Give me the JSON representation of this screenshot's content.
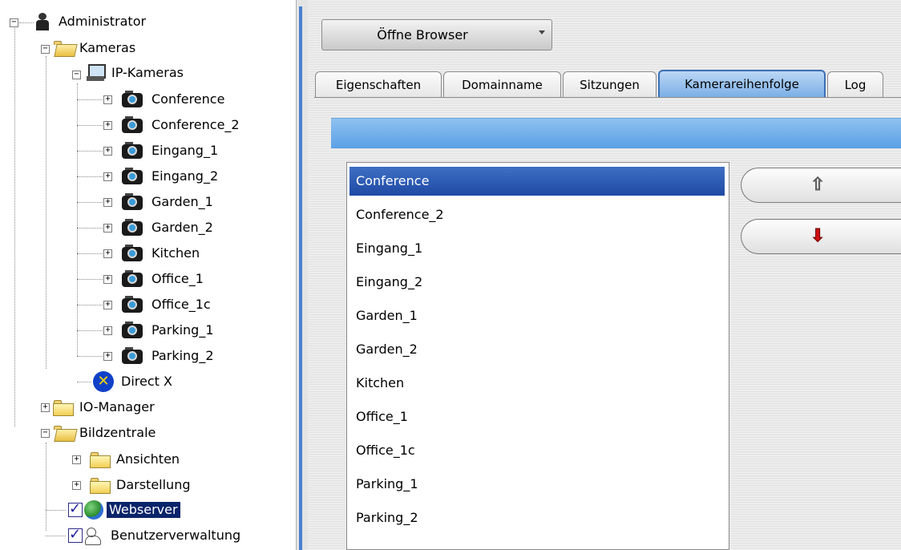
{
  "tree": {
    "administrator": "Administrator",
    "kameras": "Kameras",
    "ip_kameras": "IP-Kameras",
    "cameras": [
      "Conference",
      "Conference_2",
      "Eingang_1",
      "Eingang_2",
      "Garden_1",
      "Garden_2",
      "Kitchen",
      "Office_1",
      "Office_1c",
      "Parking_1",
      "Parking_2"
    ],
    "direct_x": "Direct X",
    "io_manager": "IO-Manager",
    "bildzentrale": "Bildzentrale",
    "ansichten": "Ansichten",
    "darstellung": "Darstellung",
    "webserver": "Webserver",
    "benutzerverwaltung": "Benutzerverwaltung",
    "selected": "Webserver"
  },
  "toolbar": {
    "browser_button": "Öffne Browser"
  },
  "tabs": [
    {
      "label": "Eigenschaften",
      "active": false
    },
    {
      "label": "Domainname",
      "active": false
    },
    {
      "label": "Sitzungen",
      "active": false
    },
    {
      "label": "Kamerareihenfolge",
      "active": true
    },
    {
      "label": "Log",
      "active": false
    }
  ],
  "camera_order": {
    "items": [
      "Conference",
      "Conference_2",
      "Eingang_1",
      "Eingang_2",
      "Garden_1",
      "Garden_2",
      "Kitchen",
      "Office_1",
      "Office_1c",
      "Parking_1",
      "Parking_2"
    ],
    "selected": "Conference",
    "up_icon": "arrow-up-icon",
    "down_icon": "arrow-down-icon"
  },
  "colors": {
    "accent_blue": "#4a7fd0",
    "selection": "#1f49a4",
    "tree_selection": "#0a246a",
    "down_arrow": "#d01010"
  }
}
